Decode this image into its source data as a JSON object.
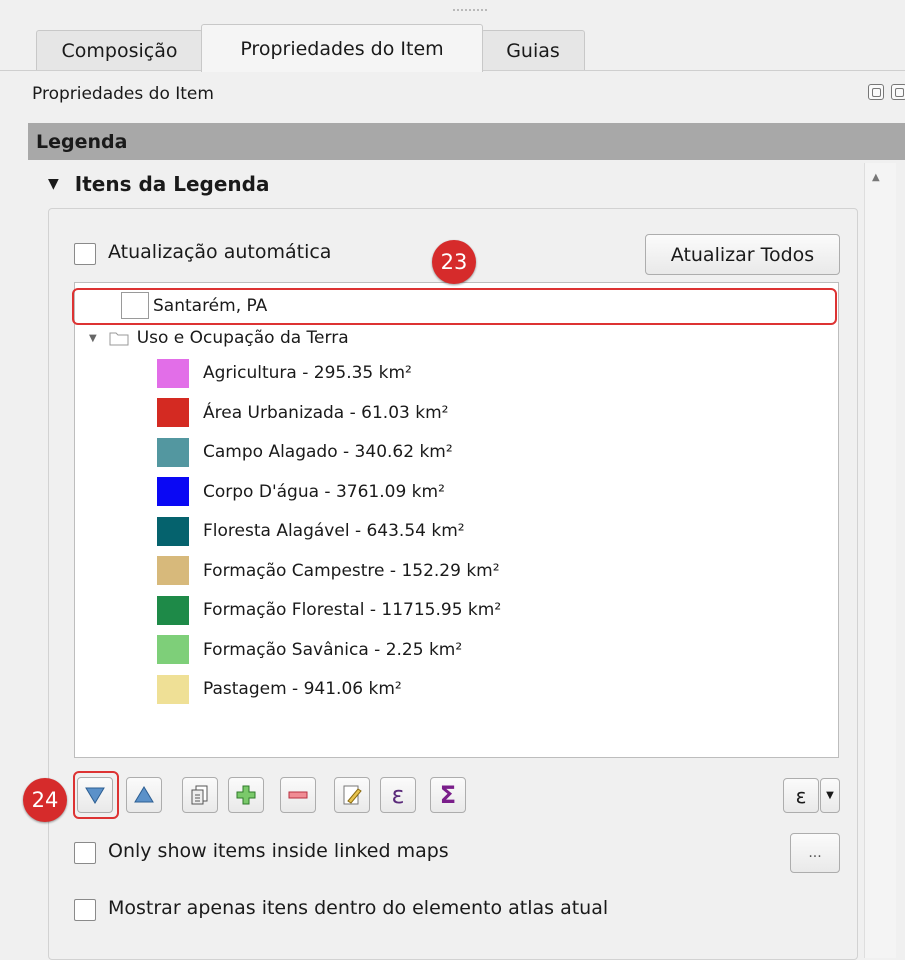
{
  "tabs": [
    {
      "label": "Composição"
    },
    {
      "label": "Propriedades do Item"
    },
    {
      "label": "Guias"
    }
  ],
  "panel": {
    "title": "Propriedades do Item"
  },
  "section": {
    "title": "Legenda"
  },
  "group": {
    "title": "Itens da Legenda"
  },
  "options": {
    "auto_update_label": "Atualização automática",
    "update_all_label": "Atualizar Todos",
    "linked_maps_label": "Only show items inside linked maps",
    "atlas_label": "Mostrar apenas itens dentro do elemento atlas atual",
    "more_label": "..."
  },
  "tree": {
    "layer1": "Santarém, PA",
    "group": "Uso e Ocupação da Terra",
    "items": [
      {
        "label": "Agricultura - 295.35 km²",
        "color": "#e26ee8"
      },
      {
        "label": "Área Urbanizada - 61.03 km²",
        "color": "#d42a22"
      },
      {
        "label": "Campo Alagado - 340.62 km²",
        "color": "#5397a0"
      },
      {
        "label": "Corpo D'água - 3761.09 km²",
        "color": "#0a08f4"
      },
      {
        "label": "Floresta Alagável - 643.54 km²",
        "color": "#05626d"
      },
      {
        "label": "Formação Campestre - 152.29 km²",
        "color": "#d7b97b"
      },
      {
        "label": "Formação Florestal - 11715.95 km²",
        "color": "#1e8a48"
      },
      {
        "label": "Formação Savânica - 2.25 km²",
        "color": "#7ecf79"
      },
      {
        "label": "Pastagem - 941.06 km²",
        "color": "#efe096"
      }
    ]
  },
  "annotations": {
    "badge1": "23",
    "badge2": "24"
  },
  "toolbar": {
    "expr_label": "ε",
    "sum_label": "Σ",
    "filter_label": "ε"
  },
  "colors": {
    "annotation_red": "#d62b2b",
    "section_header": "#a8a8a8"
  }
}
